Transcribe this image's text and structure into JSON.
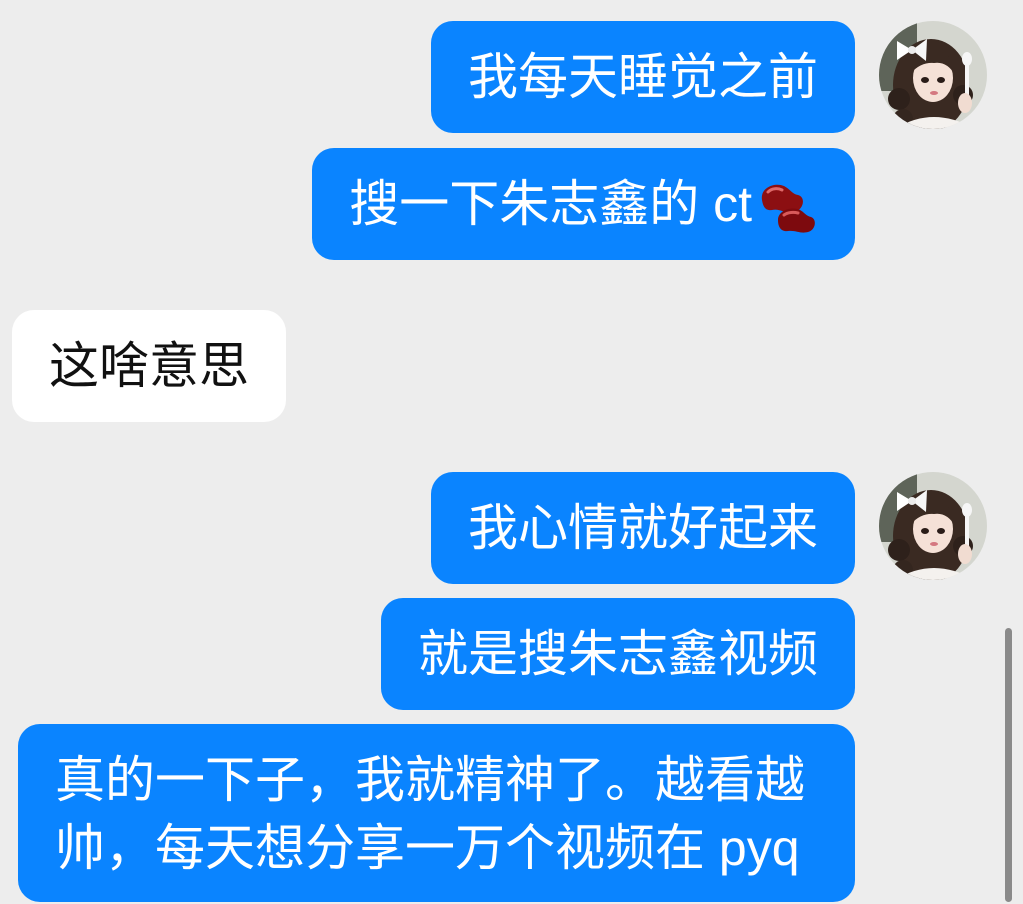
{
  "theme": {
    "background": "#ededed",
    "outgoing_bubble": "#0a84ff",
    "outgoing_text": "#ffffff",
    "incoming_bubble": "#ffffff",
    "incoming_text": "#111111"
  },
  "avatar": {
    "icon": "user-avatar-photo"
  },
  "messages": [
    {
      "sender": "self",
      "text": "我每天睡觉之前"
    },
    {
      "sender": "self",
      "text": "搜一下朱志鑫的 ct",
      "emoji_icon": "kidney-bean-emoji"
    },
    {
      "sender": "other",
      "text": "这啥意思"
    },
    {
      "sender": "self",
      "text": "我心情就好起来"
    },
    {
      "sender": "self",
      "text": "就是搜朱志鑫视频"
    },
    {
      "sender": "self",
      "text": "真的一下子，我就精神了。越看越帅，每天想分享一万个视频在 pyq"
    }
  ]
}
